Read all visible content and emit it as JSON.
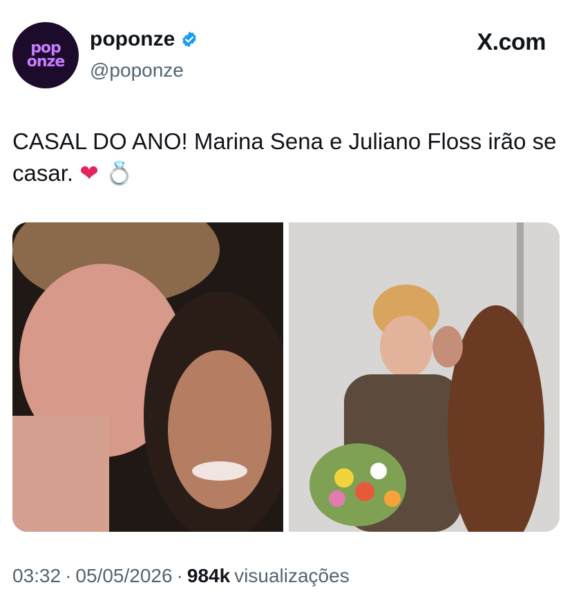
{
  "account": {
    "avatar_line1": "pop",
    "avatar_line2": "onze",
    "name": "poponze",
    "handle": "@poponze",
    "verified": true
  },
  "brand": {
    "site": "X.com"
  },
  "tweet": {
    "text": "CASAL DO ANO! Marina Sena e Juliano Floss irão se casar.",
    "emoji_heart": "❤",
    "emoji_ring": "💍"
  },
  "meta": {
    "time": "03:32",
    "sep1": "·",
    "date": "05/05/2026",
    "sep2": "·",
    "views_count": "984k",
    "views_label": "visualizações"
  },
  "colors": {
    "accent": "#1d9bf0",
    "text_primary": "#0f1419",
    "text_secondary": "#536471",
    "avatar_bg": "#1d0b2c",
    "avatar_text": "#c77dff"
  }
}
